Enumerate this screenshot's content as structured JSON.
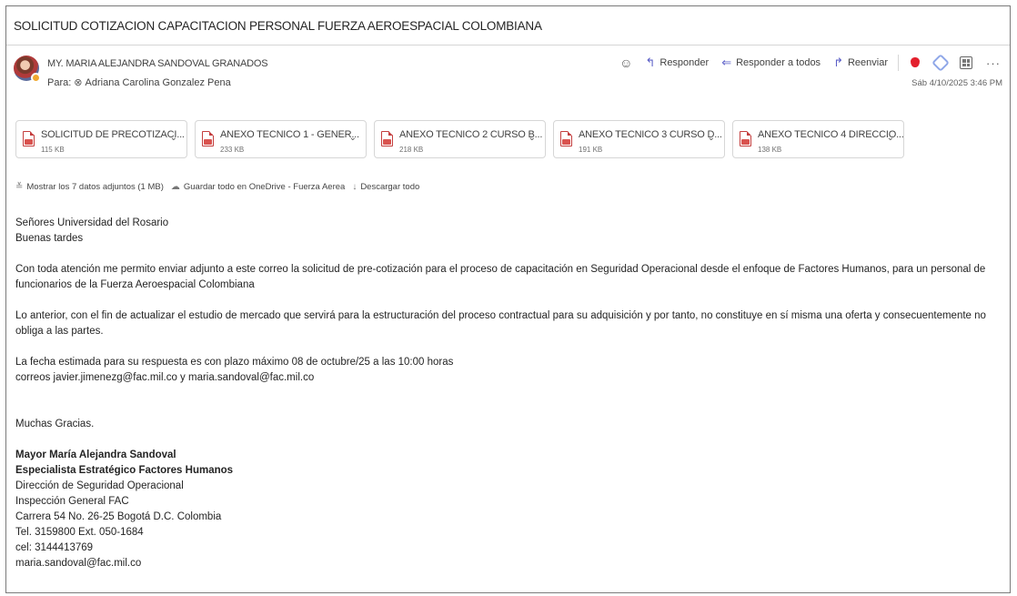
{
  "subject": "SOLICITUD COTIZACION CAPACITACION PERSONAL FUERZA AEROESPACIAL COLOMBIANA",
  "sender": {
    "name": "MY. MARIA ALEJANDRA SANDOVAL GRANADOS",
    "to_label": "Para:",
    "to_name": "Adriana Carolina Gonzalez Pena",
    "date": "Sáb 4/10/2025 3:46 PM"
  },
  "actions": {
    "reply": "Responder",
    "reply_all": "Responder a todos",
    "forward": "Reenviar"
  },
  "attachments": [
    {
      "name": "SOLICITUD DE PRECOTIZACI...",
      "size": "115 KB"
    },
    {
      "name": "ANEXO TECNICO 1 - GENER...",
      "size": "233 KB"
    },
    {
      "name": "ANEXO TECNICO 2 CURSO B...",
      "size": "218 KB"
    },
    {
      "name": "ANEXO TECNICO 3 CURSO D...",
      "size": "191 KB"
    },
    {
      "name": "ANEXO TECNICO 4 DIRECCIO...",
      "size": "138 KB"
    }
  ],
  "attachment_links": {
    "show_all": "Mostrar los 7 datos adjuntos (1 MB)",
    "save_onedrive": "Guardar todo en OneDrive - Fuerza Aerea",
    "download_all": "Descargar todo"
  },
  "body": {
    "greeting1": "Señores Universidad del Rosario",
    "greeting2": "Buenas tardes",
    "para1": "Con toda atención me permito enviar adjunto a este correo la solicitud de pre-cotización para el proceso de capacitación en Seguridad Operacional desde el enfoque de Factores Humanos, para un personal de funcionarios de la Fuerza Aeroespacial Colombiana",
    "para2": "Lo anterior, con el fin de actualizar el estudio de mercado que servirá para la estructuración del proceso contractual para su adquisición y por tanto, no constituye en sí misma una oferta y consecuentemente no obliga a las partes.",
    "para3_line1": "La fecha estimada para su respuesta es con plazo máximo 08 de octubre/25 a  las 10:00 horas",
    "para3_line2": "correos javier.jimenezg@fac.mil.co y maria.sandoval@fac.mil.co",
    "thanks": "Muchas Gracias.",
    "sig_name": "Mayor María Alejandra Sandoval",
    "sig_title": "Especialista Estratégico Factores Humanos",
    "sig_dept": "Dirección de Seguridad Operacional",
    "sig_unit": "Inspección General FAC",
    "sig_address": "Carrera 54 No. 26-25  Bogotá D.C. Colombia",
    "sig_tel": "Tel. 3159800  Ext. 050-1684",
    "sig_cel": "cel: 3144413769",
    "sig_email": "maria.sandoval@fac.mil.co"
  }
}
